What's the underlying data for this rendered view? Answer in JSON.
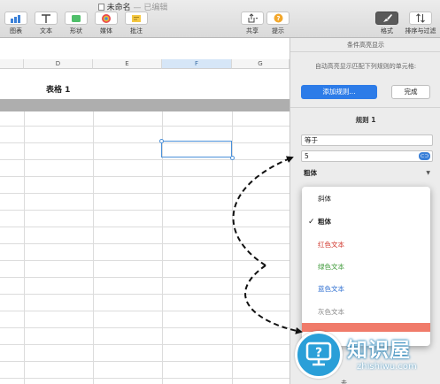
{
  "window": {
    "title": "未命名",
    "edited": "— 已编辑"
  },
  "toolbar": {
    "items": [
      {
        "label": "图表",
        "icon": "chart-icon"
      },
      {
        "label": "文本",
        "icon": "text-icon"
      },
      {
        "label": "形状",
        "icon": "shape-icon"
      },
      {
        "label": "媒体",
        "icon": "media-icon"
      },
      {
        "label": "批注",
        "icon": "comment-icon"
      }
    ],
    "share_label": "共享",
    "tips_label": "提示",
    "format_label": "格式",
    "sort_label": "排序与过滤"
  },
  "sheet": {
    "columns": [
      "D",
      "E",
      "F",
      "G"
    ],
    "selected_column": "F",
    "table_title": "表格 1"
  },
  "panel": {
    "title": "条件高亮显示",
    "description": "自动高亮显示匹配下列规则的单元格:",
    "add_rule_label": "添加规则...",
    "done_label": "完成",
    "rule_title": "规则 1",
    "condition": "等于",
    "value": "5",
    "style": "粗体"
  },
  "menu": {
    "items": [
      {
        "label": "斜体",
        "color": "#222222",
        "checked": false,
        "bold": false
      },
      {
        "label": "粗体",
        "color": "#222222",
        "checked": true,
        "bold": true
      },
      {
        "label": "红色文本",
        "color": "#d0352b",
        "checked": false,
        "bold": false
      },
      {
        "label": "绿色文本",
        "color": "#3f9a3a",
        "checked": false,
        "bold": false
      },
      {
        "label": "蓝色文本",
        "color": "#2e6fd1",
        "checked": false,
        "bold": false
      },
      {
        "label": "灰色文本",
        "color": "#8a8a8a",
        "checked": false,
        "bold": false
      }
    ]
  },
  "watermark": {
    "name": "知识屋",
    "url": "zhishiwu.com",
    "tail": "去"
  },
  "colors": {
    "accent": "#2d7ce8",
    "selection": "#4a90d9"
  }
}
